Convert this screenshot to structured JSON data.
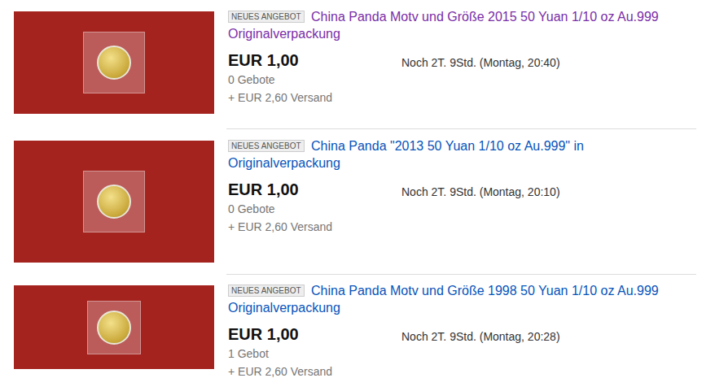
{
  "listings": [
    {
      "badge": "NEUES ANGEBOT",
      "title": "China Panda Motv und Größe 2015 50 Yuan 1/10 oz Au.999 Originalverpackung",
      "visited": true,
      "price": "EUR 1,00",
      "time": "Noch 2T. 9Std. (Montag, 20:40)",
      "bids": "0 Gebote",
      "shipping": "+ EUR 2,60 Versand"
    },
    {
      "badge": "NEUES ANGEBOT",
      "title": "China Panda \"2013 50 Yuan 1/10 oz Au.999\" in Originalverpackung",
      "visited": false,
      "price": "EUR 1,00",
      "time": "Noch 2T. 9Std. (Montag, 20:10)",
      "bids": "0 Gebote",
      "shipping": "+ EUR 2,60 Versand"
    },
    {
      "badge": "NEUES ANGEBOT",
      "title": "China Panda Motv und Größe 1998 50 Yuan 1/10 oz Au.999 Originalverpackung",
      "visited": false,
      "price": "EUR 1,00",
      "time": "Noch 2T. 9Std. (Montag, 20:28)",
      "bids": "1 Gebot",
      "shipping": "+ EUR 2,60 Versand"
    }
  ]
}
